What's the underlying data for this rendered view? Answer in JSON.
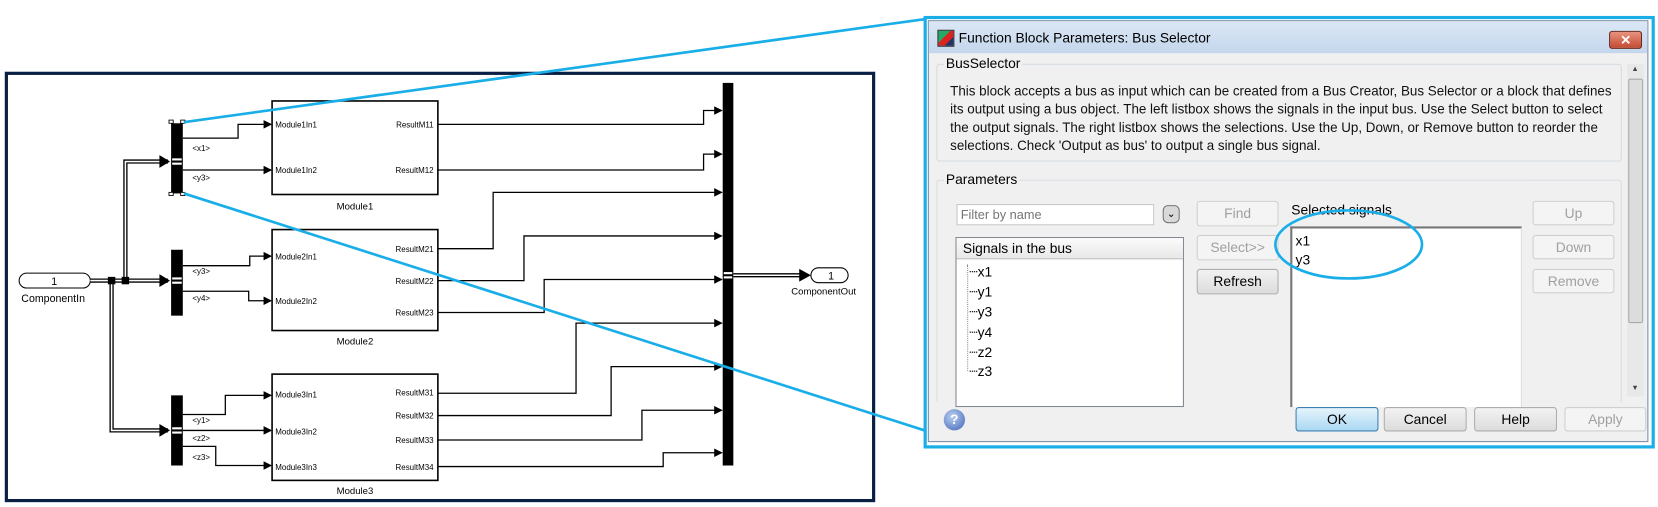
{
  "diagram": {
    "inport": {
      "number": "1",
      "label": "ComponentIn"
    },
    "outport": {
      "number": "1",
      "label": "ComponentOut"
    },
    "selector1_signals": [
      "<x1>",
      "<y3>"
    ],
    "selector2_signals": [
      "<y3>",
      "<y4>"
    ],
    "selector3_signals": [
      "<y1>",
      "<z2>",
      "<z3>"
    ],
    "modules": [
      {
        "name": "Module1",
        "inputs": [
          "Module1In1",
          "Module1In2"
        ],
        "outputs": [
          "ResultM11",
          "ResultM12"
        ]
      },
      {
        "name": "Module2",
        "inputs": [
          "Module2In1",
          "Module2In2"
        ],
        "outputs": [
          "ResultM21",
          "ResultM22",
          "ResultM23"
        ]
      },
      {
        "name": "Module3",
        "inputs": [
          "Module3In1",
          "Module3In2",
          "Module3In3"
        ],
        "outputs": [
          "ResultM31",
          "ResultM32",
          "ResultM33",
          "ResultM34"
        ]
      }
    ],
    "callout_color": "#19aee8",
    "frame_color": "#0a1f44"
  },
  "dialog": {
    "title": "Function Block Parameters: Bus Selector",
    "close_icon": "close-x",
    "block_group": "BusSelector",
    "description": "This block accepts a bus as input which can be created from a Bus Creator, Bus Selector or a block that defines its output using a bus object. The left listbox shows the signals in the input bus. Use the Select button to select the output signals. The right listbox shows the selections. Use the Up, Down, or Remove button to reorder the selections. Check 'Output as bus' to output a single bus signal.",
    "params_group": "Parameters",
    "filter_placeholder": "Filter by name",
    "find": "Find",
    "select": "Select>>",
    "refresh": "Refresh",
    "signals_header": "Signals in the bus",
    "signals": [
      "x1",
      "y1",
      "y3",
      "y4",
      "z2",
      "z3"
    ],
    "selected_label": "Selected signals",
    "selected": [
      "x1",
      "y3"
    ],
    "up": "Up",
    "down": "Down",
    "remove": "Remove",
    "ok": "OK",
    "cancel": "Cancel",
    "help": "Help",
    "apply": "Apply"
  }
}
